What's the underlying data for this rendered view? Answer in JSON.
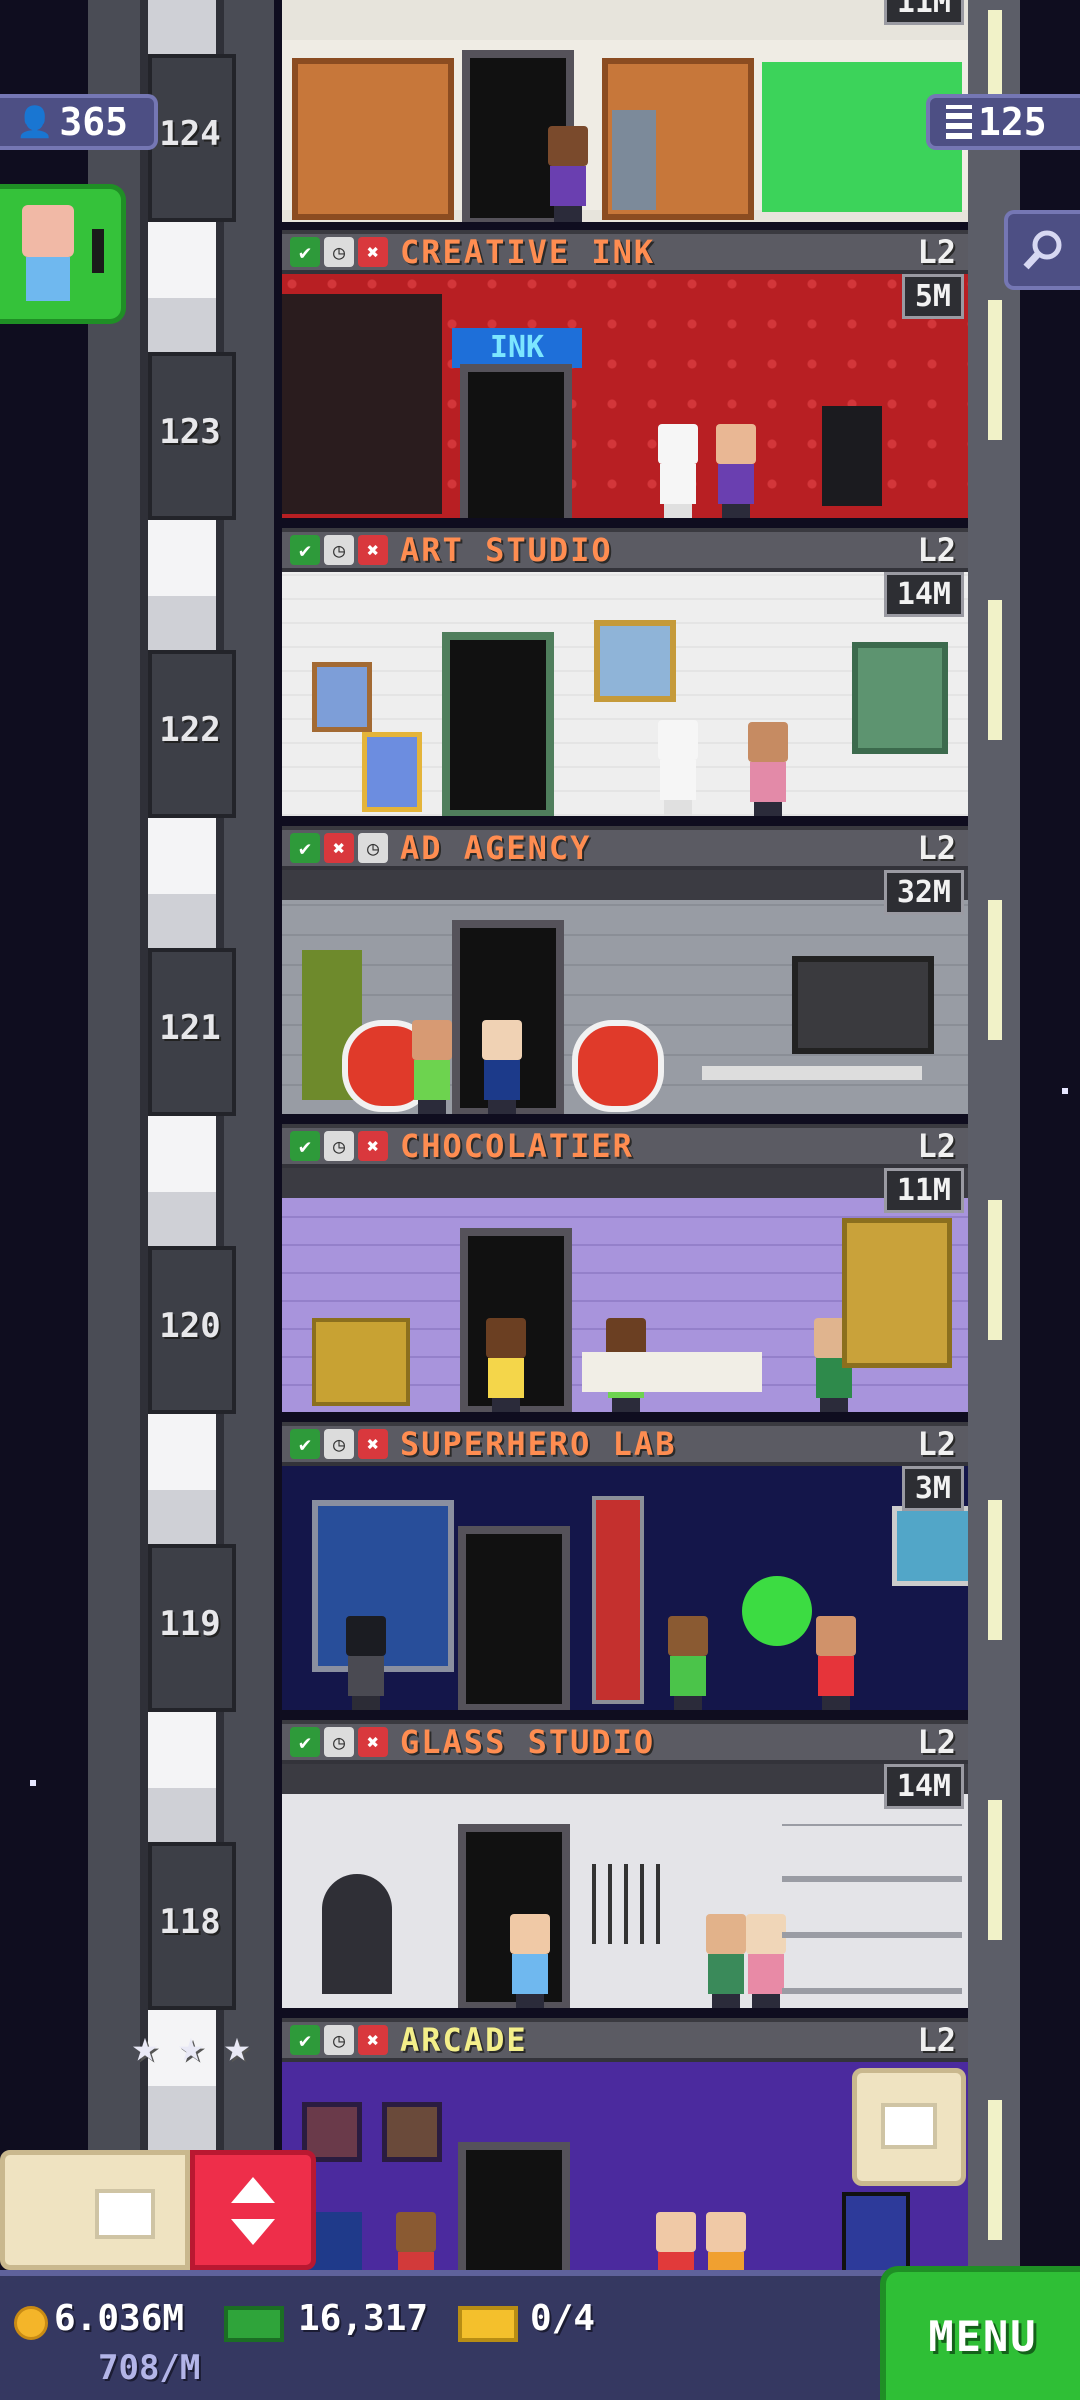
{
  "hud": {
    "population": "365",
    "floors": "125",
    "coins": "6.036M",
    "coin_rate": "708/M",
    "bux": "16,317",
    "tickets": "0/4",
    "menu_label": "MENU"
  },
  "top_floor_price": "11M",
  "floors": [
    {
      "number": "124",
      "name": "CREATIVE INK",
      "level": "L2",
      "price": "5M",
      "status": [
        "check",
        "clock",
        "x"
      ]
    },
    {
      "number": "123",
      "name": "ART STUDIO",
      "level": "L2",
      "price": "14M",
      "status": [
        "check",
        "clock",
        "x"
      ]
    },
    {
      "number": "122",
      "name": "AD AGENCY",
      "level": "L2",
      "price": "32M",
      "status": [
        "check",
        "x",
        "clock"
      ]
    },
    {
      "number": "121",
      "name": "CHOCOLATIER",
      "level": "L2",
      "price": "11M",
      "status": [
        "check",
        "clock",
        "x"
      ]
    },
    {
      "number": "120",
      "name": "SUPERHERO LAB",
      "level": "L2",
      "price": "3M",
      "status": [
        "check",
        "clock",
        "x"
      ]
    },
    {
      "number": "119",
      "name": "GLASS STUDIO",
      "level": "L2",
      "price": "14M",
      "status": [
        "check",
        "clock",
        "x"
      ]
    },
    {
      "number": "118",
      "name": "ARCADE",
      "level": "L2",
      "price": "",
      "status": [
        "check",
        "clock",
        "x"
      ]
    }
  ],
  "colors": {
    "hud_bar": "#353861",
    "menu_green": "#2fbf36",
    "elevator_red": "#ee2e4a",
    "room_name_orange": "#ff8d51",
    "room_name_yellow": "#f4ef8a"
  },
  "icons": [
    "person-icon",
    "building-icon",
    "search-icon",
    "coin-icon",
    "bux-icon",
    "ticket-icon",
    "star-icon",
    "elevator-arrows-icon",
    "box-icon"
  ]
}
